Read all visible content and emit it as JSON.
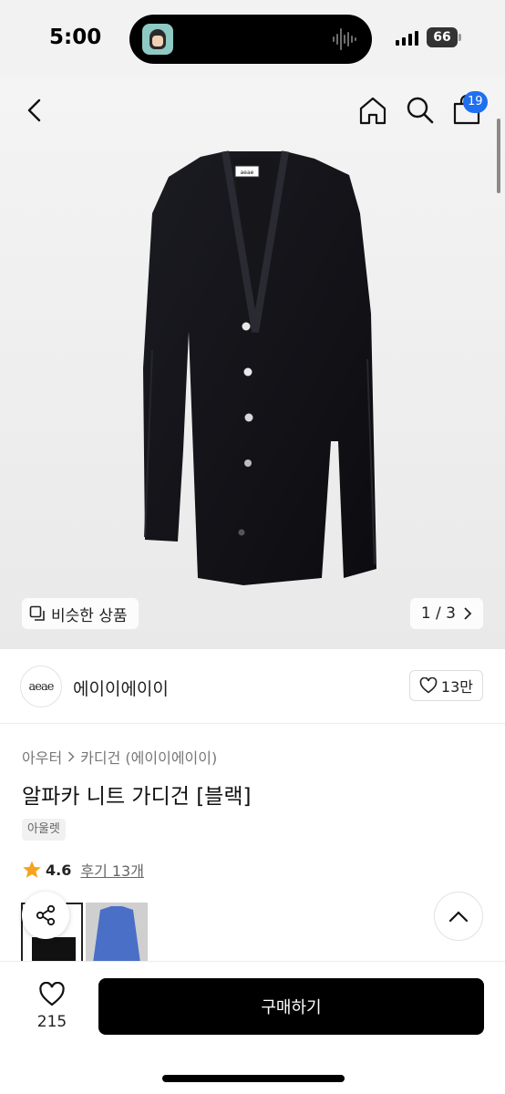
{
  "status_bar": {
    "time": "5:00",
    "battery": "66"
  },
  "header": {
    "cart_count": "19"
  },
  "gallery": {
    "similar_label": "비슷한 상품",
    "pager": "1 / 3"
  },
  "brand": {
    "logo_text": "aeae",
    "name": "에이이에이이",
    "likes": "13만"
  },
  "product": {
    "breadcrumb": [
      "아우터",
      "카디건 (에이이에이이)"
    ],
    "title": "알파카 니트 가디건 [블랙]",
    "tag": "아울렛",
    "rating": "4.6",
    "reviews": "후기 13개"
  },
  "bottom_bar": {
    "wish_count": "215",
    "buy_label": "구매하기"
  },
  "colors": {
    "accent": "#1f6ff0",
    "star": "#f7a21b",
    "buy": "#000000"
  },
  "icons": [
    "back-icon",
    "home-icon",
    "search-icon",
    "bag-icon",
    "similar-icon",
    "chevron-right-icon",
    "heart-icon",
    "star-icon",
    "share-icon",
    "chevron-up-icon"
  ]
}
